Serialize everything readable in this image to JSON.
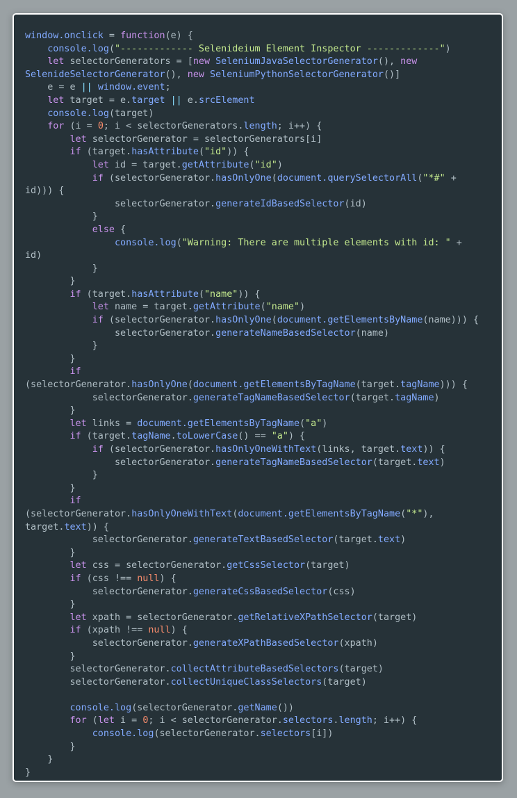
{
  "editor": {
    "language": "javascript",
    "theme": {
      "background": "#263238",
      "border": "#ffffff",
      "page_background": "#9aa1a4",
      "keyword": "#c792ea",
      "function": "#82aaff",
      "string": "#c3e88d",
      "number": "#f78c6c",
      "operator": "#89ddff",
      "text": "#b0bec5"
    },
    "lines": [
      [
        [
          "f",
          "window.onclick"
        ],
        [
          "t",
          " = "
        ],
        [
          "k",
          "function"
        ],
        [
          "t",
          "(e) {"
        ]
      ],
      [
        [
          "t",
          "    "
        ],
        [
          "f",
          "console.log"
        ],
        [
          "t",
          "("
        ],
        [
          "s",
          "\"------------- Selenideium Element Inspector -------------\""
        ],
        [
          "t",
          ")"
        ]
      ],
      [
        [
          "t",
          "    "
        ],
        [
          "k",
          "let"
        ],
        [
          "t",
          " selectorGenerators = ["
        ],
        [
          "k",
          "new"
        ],
        [
          "t",
          " "
        ],
        [
          "f",
          "SeleniumJavaSelectorGenerator"
        ],
        [
          "t",
          "(), "
        ],
        [
          "k",
          "new"
        ]
      ],
      [
        [
          "f",
          "SelenideSelectorGenerator"
        ],
        [
          "t",
          "(), "
        ],
        [
          "k",
          "new"
        ],
        [
          "t",
          " "
        ],
        [
          "f",
          "SeleniumPythonSelectorGenerator"
        ],
        [
          "t",
          "()]"
        ]
      ],
      [
        [
          "t",
          "    e = e "
        ],
        [
          "o",
          "||"
        ],
        [
          "t",
          " "
        ],
        [
          "f",
          "window.event"
        ],
        [
          "t",
          ";"
        ]
      ],
      [
        [
          "t",
          "    "
        ],
        [
          "k",
          "let"
        ],
        [
          "t",
          " target = e."
        ],
        [
          "f",
          "target"
        ],
        [
          "t",
          " "
        ],
        [
          "o",
          "||"
        ],
        [
          "t",
          " e."
        ],
        [
          "f",
          "srcElement"
        ]
      ],
      [
        [
          "t",
          "    "
        ],
        [
          "f",
          "console.log"
        ],
        [
          "t",
          "(target)"
        ]
      ],
      [
        [
          "t",
          "    "
        ],
        [
          "k",
          "for"
        ],
        [
          "t",
          " (i = "
        ],
        [
          "n",
          "0"
        ],
        [
          "t",
          "; i < selectorGenerators."
        ],
        [
          "f",
          "length"
        ],
        [
          "t",
          "; i++) {"
        ]
      ],
      [
        [
          "t",
          "        "
        ],
        [
          "k",
          "let"
        ],
        [
          "t",
          " selectorGenerator = selectorGenerators[i]"
        ]
      ],
      [
        [
          "t",
          "        "
        ],
        [
          "k",
          "if"
        ],
        [
          "t",
          " (target."
        ],
        [
          "f",
          "hasAttribute"
        ],
        [
          "t",
          "("
        ],
        [
          "s",
          "\"id\""
        ],
        [
          "t",
          ")) {"
        ]
      ],
      [
        [
          "t",
          "            "
        ],
        [
          "k",
          "let"
        ],
        [
          "t",
          " id = target."
        ],
        [
          "f",
          "getAttribute"
        ],
        [
          "t",
          "("
        ],
        [
          "s",
          "\"id\""
        ],
        [
          "t",
          ")"
        ]
      ],
      [
        [
          "t",
          "            "
        ],
        [
          "k",
          "if"
        ],
        [
          "t",
          " (selectorGenerator."
        ],
        [
          "f",
          "hasOnlyOne"
        ],
        [
          "t",
          "("
        ],
        [
          "f",
          "document.querySelectorAll"
        ],
        [
          "t",
          "("
        ],
        [
          "s",
          "\"*#\""
        ],
        [
          "t",
          " +"
        ]
      ],
      [
        [
          "t",
          "id))) {"
        ]
      ],
      [
        [
          "t",
          "                selectorGenerator."
        ],
        [
          "f",
          "generateIdBasedSelector"
        ],
        [
          "t",
          "(id)"
        ]
      ],
      [
        [
          "t",
          "            }"
        ]
      ],
      [
        [
          "t",
          "            "
        ],
        [
          "k",
          "else"
        ],
        [
          "t",
          " {"
        ]
      ],
      [
        [
          "t",
          "                "
        ],
        [
          "f",
          "console.log"
        ],
        [
          "t",
          "("
        ],
        [
          "s",
          "\"Warning: There are multiple elements with id: \""
        ],
        [
          "t",
          " +"
        ]
      ],
      [
        [
          "t",
          "id)"
        ]
      ],
      [
        [
          "t",
          "            }"
        ]
      ],
      [
        [
          "t",
          "        }"
        ]
      ],
      [
        [
          "t",
          "        "
        ],
        [
          "k",
          "if"
        ],
        [
          "t",
          " (target."
        ],
        [
          "f",
          "hasAttribute"
        ],
        [
          "t",
          "("
        ],
        [
          "s",
          "\"name\""
        ],
        [
          "t",
          ")) {"
        ]
      ],
      [
        [
          "t",
          "            "
        ],
        [
          "k",
          "let"
        ],
        [
          "t",
          " name = target."
        ],
        [
          "f",
          "getAttribute"
        ],
        [
          "t",
          "("
        ],
        [
          "s",
          "\"name\""
        ],
        [
          "t",
          ")"
        ]
      ],
      [
        [
          "t",
          "            "
        ],
        [
          "k",
          "if"
        ],
        [
          "t",
          " (selectorGenerator."
        ],
        [
          "f",
          "hasOnlyOne"
        ],
        [
          "t",
          "("
        ],
        [
          "f",
          "document.getElementsByName"
        ],
        [
          "t",
          "(name))) {"
        ]
      ],
      [
        [
          "t",
          "                selectorGenerator."
        ],
        [
          "f",
          "generateNameBasedSelector"
        ],
        [
          "t",
          "(name)"
        ]
      ],
      [
        [
          "t",
          "            }"
        ]
      ],
      [
        [
          "t",
          "        }"
        ]
      ],
      [
        [
          "t",
          "        "
        ],
        [
          "k",
          "if"
        ]
      ],
      [
        [
          "t",
          "(selectorGenerator."
        ],
        [
          "f",
          "hasOnlyOne"
        ],
        [
          "t",
          "("
        ],
        [
          "f",
          "document.getElementsByTagName"
        ],
        [
          "t",
          "(target."
        ],
        [
          "f",
          "tagName"
        ],
        [
          "t",
          "))) {"
        ]
      ],
      [
        [
          "t",
          "            selectorGenerator."
        ],
        [
          "f",
          "generateTagNameBasedSelector"
        ],
        [
          "t",
          "(target."
        ],
        [
          "f",
          "tagName"
        ],
        [
          "t",
          ")"
        ]
      ],
      [
        [
          "t",
          "        }"
        ]
      ],
      [
        [
          "t",
          "        "
        ],
        [
          "k",
          "let"
        ],
        [
          "t",
          " links = "
        ],
        [
          "f",
          "document.getElementsByTagName"
        ],
        [
          "t",
          "("
        ],
        [
          "s",
          "\"a\""
        ],
        [
          "t",
          ")"
        ]
      ],
      [
        [
          "t",
          "        "
        ],
        [
          "k",
          "if"
        ],
        [
          "t",
          " (target."
        ],
        [
          "f",
          "tagName"
        ],
        [
          "t",
          "."
        ],
        [
          "f",
          "toLowerCase"
        ],
        [
          "t",
          "() == "
        ],
        [
          "s",
          "\"a\""
        ],
        [
          "t",
          ") {"
        ]
      ],
      [
        [
          "t",
          "            "
        ],
        [
          "k",
          "if"
        ],
        [
          "t",
          " (selectorGenerator."
        ],
        [
          "f",
          "hasOnlyOneWithText"
        ],
        [
          "t",
          "(links, target."
        ],
        [
          "f",
          "text"
        ],
        [
          "t",
          ")) {"
        ]
      ],
      [
        [
          "t",
          "                selectorGenerator."
        ],
        [
          "f",
          "generateTagNameBasedSelector"
        ],
        [
          "t",
          "(target."
        ],
        [
          "f",
          "text"
        ],
        [
          "t",
          ")"
        ]
      ],
      [
        [
          "t",
          "            }"
        ]
      ],
      [
        [
          "t",
          "        }"
        ]
      ],
      [
        [
          "t",
          "        "
        ],
        [
          "k",
          "if"
        ]
      ],
      [
        [
          "t",
          "(selectorGenerator."
        ],
        [
          "f",
          "hasOnlyOneWithText"
        ],
        [
          "t",
          "("
        ],
        [
          "f",
          "document.getElementsByTagName"
        ],
        [
          "t",
          "("
        ],
        [
          "s",
          "\"*\""
        ],
        [
          "t",
          "),"
        ]
      ],
      [
        [
          "t",
          "target."
        ],
        [
          "f",
          "text"
        ],
        [
          "t",
          ")) {"
        ]
      ],
      [
        [
          "t",
          "            selectorGenerator."
        ],
        [
          "f",
          "generateTextBasedSelector"
        ],
        [
          "t",
          "(target."
        ],
        [
          "f",
          "text"
        ],
        [
          "t",
          ")"
        ]
      ],
      [
        [
          "t",
          "        }"
        ]
      ],
      [
        [
          "t",
          "        "
        ],
        [
          "k",
          "let"
        ],
        [
          "t",
          " css = selectorGenerator."
        ],
        [
          "f",
          "getCssSelector"
        ],
        [
          "t",
          "(target)"
        ]
      ],
      [
        [
          "t",
          "        "
        ],
        [
          "k",
          "if"
        ],
        [
          "t",
          " (css !== "
        ],
        [
          "n",
          "null"
        ],
        [
          "t",
          ") {"
        ]
      ],
      [
        [
          "t",
          "            selectorGenerator."
        ],
        [
          "f",
          "generateCssBasedSelector"
        ],
        [
          "t",
          "(css)"
        ]
      ],
      [
        [
          "t",
          "        }"
        ]
      ],
      [
        [
          "t",
          "        "
        ],
        [
          "k",
          "let"
        ],
        [
          "t",
          " xpath = selectorGenerator."
        ],
        [
          "f",
          "getRelativeXPathSelector"
        ],
        [
          "t",
          "(target)"
        ]
      ],
      [
        [
          "t",
          "        "
        ],
        [
          "k",
          "if"
        ],
        [
          "t",
          " (xpath !== "
        ],
        [
          "n",
          "null"
        ],
        [
          "t",
          ") {"
        ]
      ],
      [
        [
          "t",
          "            selectorGenerator."
        ],
        [
          "f",
          "generateXPathBasedSelector"
        ],
        [
          "t",
          "(xpath)"
        ]
      ],
      [
        [
          "t",
          "        }"
        ]
      ],
      [
        [
          "t",
          "        selectorGenerator."
        ],
        [
          "f",
          "collectAttributeBasedSelectors"
        ],
        [
          "t",
          "(target)"
        ]
      ],
      [
        [
          "t",
          "        selectorGenerator."
        ],
        [
          "f",
          "collectUniqueClassSelectors"
        ],
        [
          "t",
          "(target)"
        ]
      ],
      [
        [
          "t",
          ""
        ]
      ],
      [
        [
          "t",
          "        "
        ],
        [
          "f",
          "console.log"
        ],
        [
          "t",
          "(selectorGenerator."
        ],
        [
          "f",
          "getName"
        ],
        [
          "t",
          "())"
        ]
      ],
      [
        [
          "t",
          "        "
        ],
        [
          "k",
          "for"
        ],
        [
          "t",
          " ("
        ],
        [
          "k",
          "let"
        ],
        [
          "t",
          " i = "
        ],
        [
          "n",
          "0"
        ],
        [
          "t",
          "; i < selectorGenerator."
        ],
        [
          "f",
          "selectors"
        ],
        [
          "t",
          "."
        ],
        [
          "f",
          "length"
        ],
        [
          "t",
          "; i++) {"
        ]
      ],
      [
        [
          "t",
          "            "
        ],
        [
          "f",
          "console.log"
        ],
        [
          "t",
          "(selectorGenerator."
        ],
        [
          "f",
          "selectors"
        ],
        [
          "t",
          "[i])"
        ]
      ],
      [
        [
          "t",
          "        }"
        ]
      ],
      [
        [
          "t",
          "    }"
        ]
      ],
      [
        [
          "t",
          "}"
        ]
      ]
    ]
  }
}
